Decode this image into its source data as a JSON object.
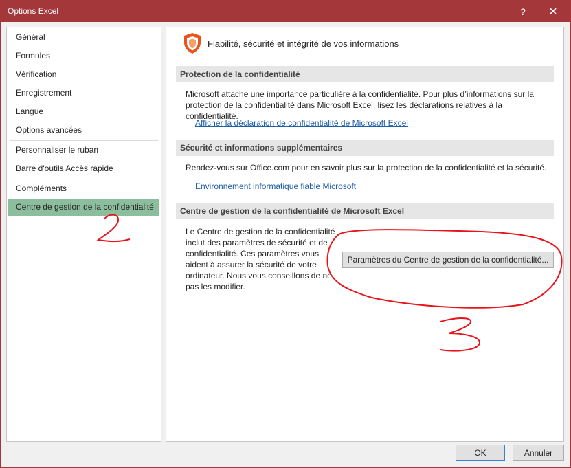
{
  "window": {
    "title": "Options Excel",
    "help_label": "?",
    "close_label": "✕"
  },
  "nav": {
    "items": [
      {
        "label": "Général"
      },
      {
        "label": "Formules"
      },
      {
        "label": "Vérification"
      },
      {
        "label": "Enregistrement"
      },
      {
        "label": "Langue"
      },
      {
        "label": "Options avancées"
      },
      {
        "label": "Personnaliser le ruban"
      },
      {
        "label": "Barre d'outils Accès rapide"
      },
      {
        "label": "Compléments"
      },
      {
        "label": "Centre de gestion de la confidentialité",
        "selected": true
      }
    ]
  },
  "main": {
    "header": "Fiabilité, sécurité et intégrité de vos informations",
    "privacy": {
      "heading": "Protection de la confidentialité",
      "text": "Microsoft attache une importance particulière à la confidentialité. Pour plus d’informations sur la protection de la confidentialité dans Microsoft Excel, lisez les déclarations relatives à la confidentialité.",
      "link": "Afficher la déclaration de confidentialité de Microsoft Excel"
    },
    "security": {
      "heading": "Sécurité et informations supplémentaires",
      "text": "Rendez-vous sur Office.com pour en savoir plus sur la protection de la confidentialité et la sécurité.",
      "link": "Environnement informatique fiable Microsoft"
    },
    "trust_center": {
      "heading": "Centre de gestion de la confidentialité de Microsoft Excel",
      "text": "Le Centre de gestion de la confidentialité inclut des paramètres de sécurité et de confidentialité. Ces paramètres vous aident à assurer la sécurité de votre ordinateur. Nous vous conseillons de ne pas les modifier.",
      "button": "Paramètres du Centre de gestion de la confidentialité..."
    }
  },
  "footer": {
    "ok": "OK",
    "cancel": "Annuler"
  },
  "colors": {
    "titlebar": "#a4373a",
    "selected": "#8cbd9c",
    "link": "#1f5ea8",
    "annotation": "#e8141c"
  }
}
